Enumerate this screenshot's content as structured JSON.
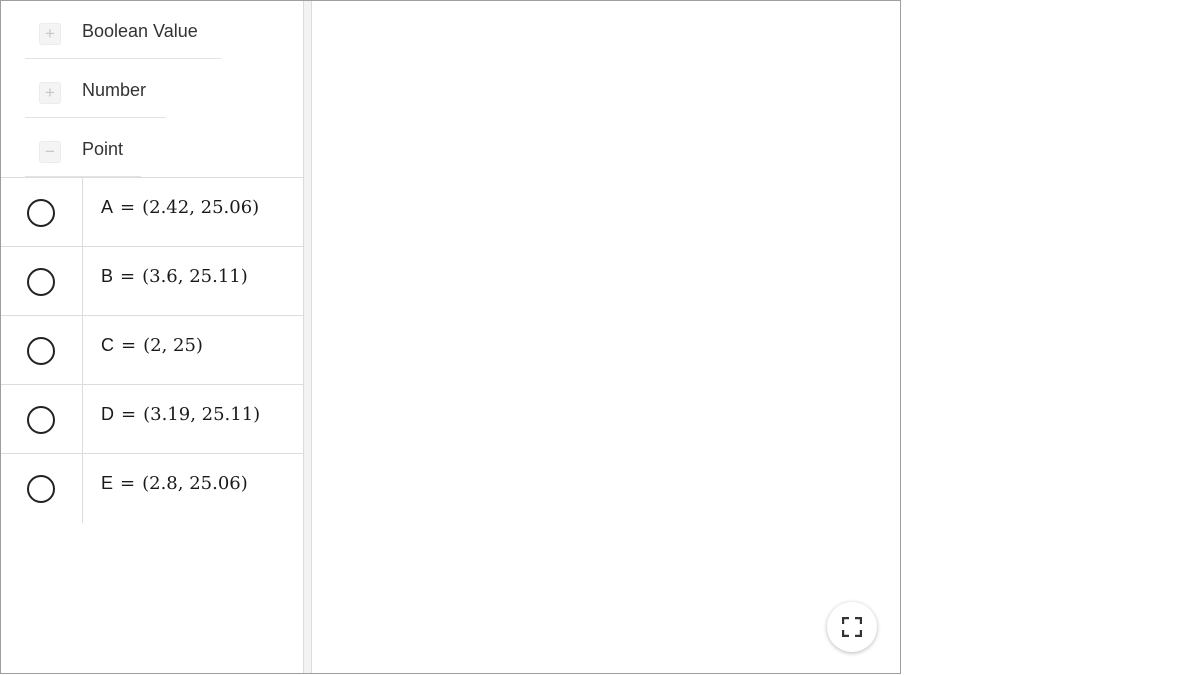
{
  "algebra": {
    "groups": [
      {
        "label": "Boolean Value",
        "state": "collapsed",
        "toggle": "+"
      },
      {
        "label": "Number",
        "state": "collapsed",
        "toggle": "+"
      },
      {
        "label": "Point",
        "state": "expanded",
        "toggle": "−"
      }
    ],
    "points": [
      {
        "name": "A",
        "eq": "=",
        "value": "(2.42, 25.06)"
      },
      {
        "name": "B",
        "eq": "=",
        "value": "(3.6, 25.11)"
      },
      {
        "name": "C",
        "eq": "=",
        "value": "(2, 25)"
      },
      {
        "name": "D",
        "eq": "=",
        "value": "(3.19, 25.11)"
      },
      {
        "name": "E",
        "eq": "=",
        "value": "(2.8, 25.06)"
      }
    ]
  },
  "icons": {
    "expand": "plus-icon",
    "collapse": "minus-icon",
    "fullscreen": "fullscreen-icon"
  }
}
